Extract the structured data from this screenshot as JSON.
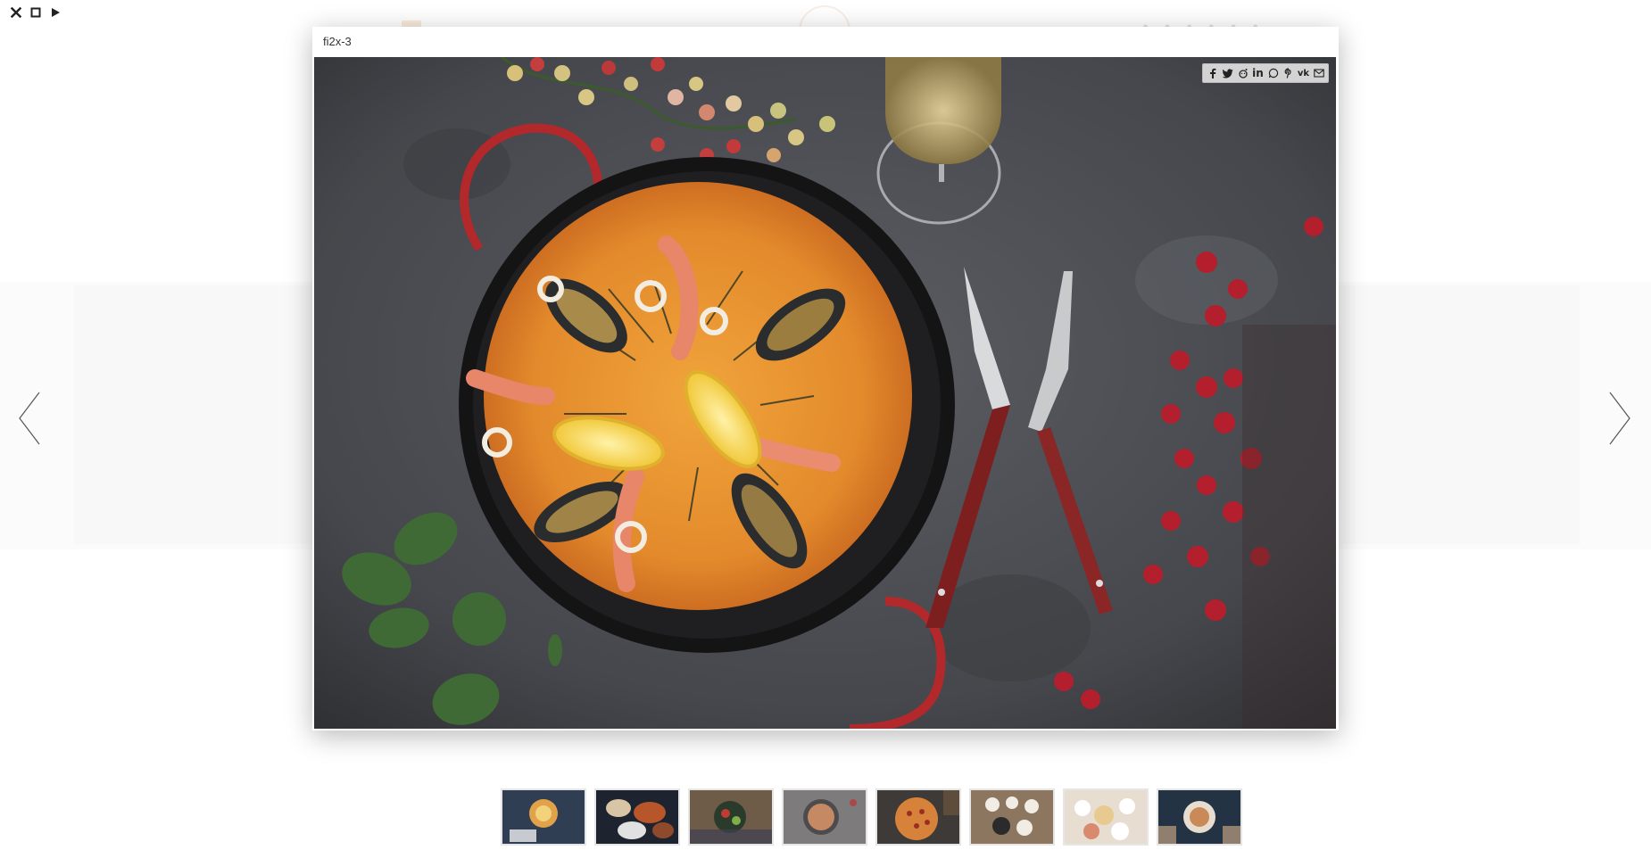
{
  "lightbox": {
    "title": "fi2x-3"
  },
  "controls": {
    "close_icon": "close-icon",
    "fullscreen_icon": "fullscreen-icon",
    "play_icon": "play-icon"
  },
  "share_icons": [
    "facebook-icon",
    "twitter-icon",
    "reddit-icon",
    "linkedin-icon",
    "whatsapp-icon",
    "pinterest-icon",
    "vk-icon",
    "email-icon"
  ],
  "navigation": {
    "prev_icon": "chevron-left-icon",
    "next_icon": "chevron-right-icon"
  },
  "thumbnails": [
    {
      "name": "thumb-1"
    },
    {
      "name": "thumb-2"
    },
    {
      "name": "thumb-3"
    },
    {
      "name": "thumb-4"
    },
    {
      "name": "thumb-5"
    },
    {
      "name": "thumb-6"
    },
    {
      "name": "thumb-7"
    },
    {
      "name": "thumb-8"
    }
  ],
  "colors": {
    "overlay_bg": "#ffffff",
    "share_bar_bg": "#d3d3d3",
    "thumb_border": "#e6e6e6"
  }
}
